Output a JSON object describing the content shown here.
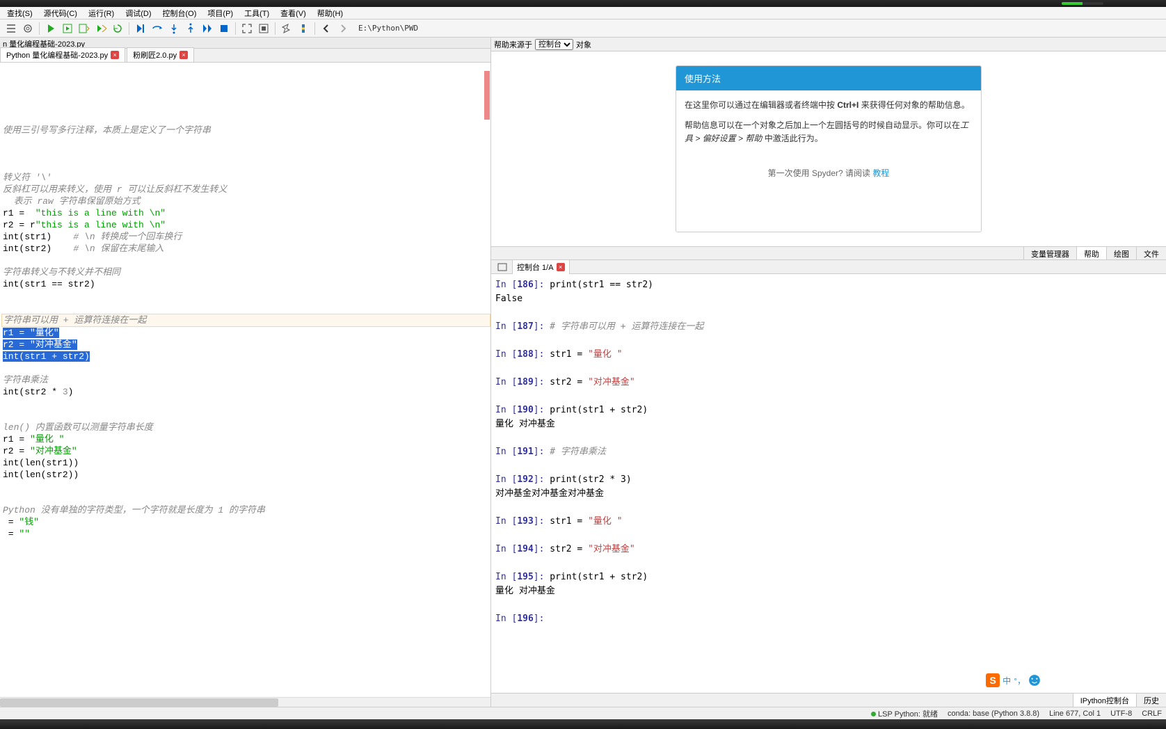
{
  "menus": [
    "查找(S)",
    "源代码(C)",
    "运行(R)",
    "调试(D)",
    "控制台(O)",
    "项目(P)",
    "工具(T)",
    "查看(V)",
    "帮助(H)"
  ],
  "toolbar_path": "E:\\Python\\PWD",
  "editor_title": "n 量化编程基础-2023.py",
  "editor_tabs": [
    {
      "label": "Python 量化编程基础-2023.py",
      "active": true
    },
    {
      "label": "粉刷匠2.0.py",
      "active": false
    }
  ],
  "code_lines": [
    {
      "type": "blank"
    },
    {
      "type": "blank"
    },
    {
      "type": "blank"
    },
    {
      "type": "blank"
    },
    {
      "type": "blank"
    },
    {
      "type": "comment",
      "text": "使用三引号写多行注释，本质上是定义了一个字符串"
    },
    {
      "type": "blank"
    },
    {
      "type": "blank"
    },
    {
      "type": "blank"
    },
    {
      "type": "comment",
      "text": "转义符 '\\'"
    },
    {
      "type": "comment",
      "text": "反斜杠可以用来转义，使用 r 可以让反斜杠不发生转义"
    },
    {
      "type": "comment",
      "text": "  表示 raw 字符串保留原始方式"
    },
    {
      "type": "code",
      "html": "r1 =  <span class='str'>\"this is a line with \\n\"</span>"
    },
    {
      "type": "code",
      "html": "r2 = r<span class='str'>\"this is a line with \\n\"</span>"
    },
    {
      "type": "code",
      "html": "int(str1)    <span class='comment'># \\n 转换成一个回车换行</span>"
    },
    {
      "type": "code",
      "html": "int(str2)    <span class='comment'># \\n 保留在末尾输入</span>"
    },
    {
      "type": "blank"
    },
    {
      "type": "comment",
      "text": "字符串转义与不转义并不相同"
    },
    {
      "type": "code",
      "html": "int(str1 == str2)"
    },
    {
      "type": "blank"
    },
    {
      "type": "blank"
    },
    {
      "type": "comment",
      "text": "字符串可以用 + 运算符连接在一起",
      "current": true
    },
    {
      "type": "selected",
      "html": "r1 = <span class='str'>\"量化\"</span>"
    },
    {
      "type": "selected",
      "html": "r2 = <span class='str'>\"对冲基金\"</span>"
    },
    {
      "type": "selected",
      "html": "int(str1 + str2)"
    },
    {
      "type": "blank"
    },
    {
      "type": "comment",
      "text": "字符串乘法"
    },
    {
      "type": "code",
      "html": "int(str2 * <span class='num'>3</span>)"
    },
    {
      "type": "blank"
    },
    {
      "type": "blank"
    },
    {
      "type": "comment",
      "text": "len() 内置函数可以测量字符串长度"
    },
    {
      "type": "code",
      "html": "r1 = <span class='str'>\"量化 \"</span>"
    },
    {
      "type": "code",
      "html": "r2 = <span class='str'>\"对冲基金\"</span>"
    },
    {
      "type": "code",
      "html": "int(len(str1))"
    },
    {
      "type": "code",
      "html": "int(len(str2))"
    },
    {
      "type": "blank"
    },
    {
      "type": "blank"
    },
    {
      "type": "comment",
      "text": "Python 没有单独的字符类型，一个字符就是长度为 1 的字符串"
    },
    {
      "type": "code",
      "html": " = <span class='str'>\"钱\"</span>"
    },
    {
      "type": "code",
      "html": " = <span class='str'>\"\"</span>"
    }
  ],
  "help": {
    "source_label": "帮助来源于",
    "source_options": [
      "控制台"
    ],
    "object_label": "对象",
    "card_title": "使用方法",
    "card_p1_a": "在这里你可以通过在编辑器或者终端中按 ",
    "card_p1_kbd": "Ctrl+I",
    "card_p1_b": " 来获得任何对象的帮助信息。",
    "card_p2_a": "帮助信息可以在一个对象之后加上一个左圆括号的时候自动显示。你可以在",
    "card_p2_i": "工具 > 偏好设置 > 帮助",
    "card_p2_b": " 中激活此行为。",
    "footer_q": "第一次使用 Spyder? 请阅读 ",
    "footer_link": "教程"
  },
  "right_tabs": [
    "变量管理器",
    "帮助",
    "绘图",
    "文件"
  ],
  "console_tab": "控制台 1/A",
  "console_lines": [
    {
      "num": "186",
      "body": "print(str1 == str2)"
    },
    {
      "out": "False"
    },
    {
      "blank": true
    },
    {
      "num": "187",
      "comment": "# 字符串可以用 + 运算符连接在一起"
    },
    {
      "blank": true
    },
    {
      "num": "188",
      "body_html": "str1 = <span class='console-str'>\"量化 \"</span>"
    },
    {
      "blank": true
    },
    {
      "num": "189",
      "body_html": "str2 = <span class='console-str'>\"对冲基金\"</span>"
    },
    {
      "blank": true
    },
    {
      "num": "190",
      "body": "print(str1 + str2)"
    },
    {
      "out": "量化 对冲基金"
    },
    {
      "blank": true
    },
    {
      "num": "191",
      "comment": "# 字符串乘法"
    },
    {
      "blank": true
    },
    {
      "num": "192",
      "body": "print(str2 * 3)"
    },
    {
      "out": "对冲基金对冲基金对冲基金"
    },
    {
      "blank": true
    },
    {
      "num": "193",
      "body_html": "str1 = <span class='console-str'>\"量化 \"</span>"
    },
    {
      "blank": true
    },
    {
      "num": "194",
      "body_html": "str2 = <span class='console-str'>\"对冲基金\"</span>"
    },
    {
      "blank": true
    },
    {
      "num": "195",
      "body": "print(str1 + str2)"
    },
    {
      "out": "量化 对冲基金"
    },
    {
      "blank": true
    },
    {
      "num": "196",
      "body": ""
    }
  ],
  "bottom_tabs": [
    "IPython控制台",
    "历史"
  ],
  "status": {
    "lsp": "LSP Python: 就绪",
    "conda": "conda: base (Python 3.8.8)",
    "line": "Line 677, Col 1",
    "encoding": "UTF-8",
    "eol": "CRLF"
  },
  "ime": {
    "s": "S",
    "lang": "中"
  }
}
